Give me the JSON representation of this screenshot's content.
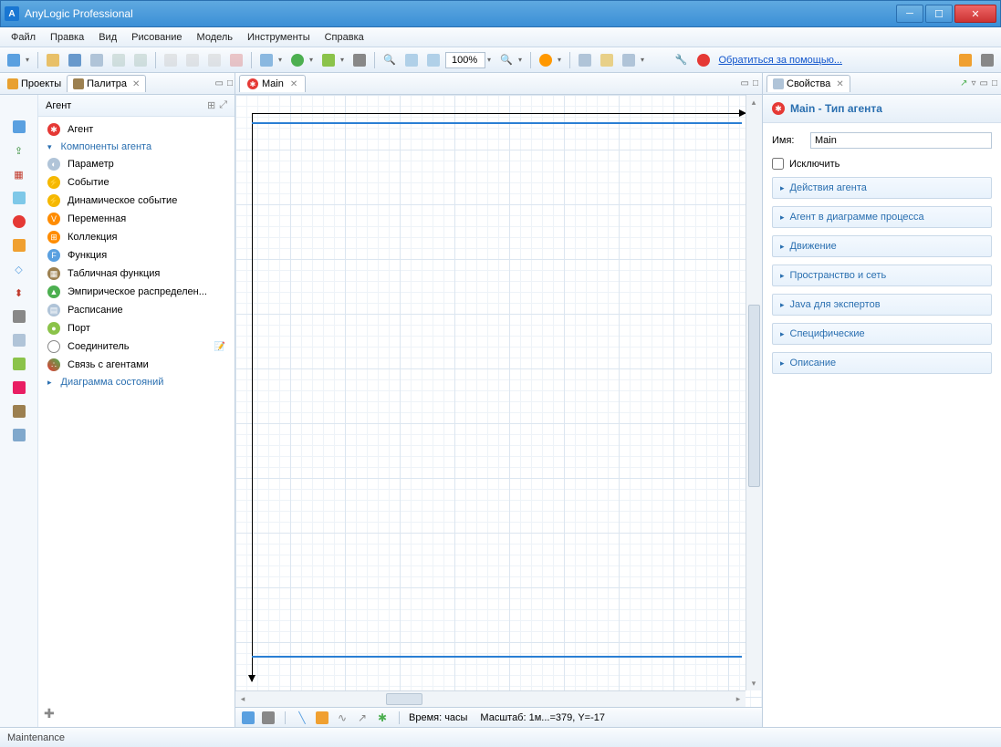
{
  "window": {
    "title": "AnyLogic Professional"
  },
  "menu": {
    "file": "Файл",
    "edit": "Правка",
    "view": "Вид",
    "draw": "Рисование",
    "model": "Модель",
    "tools": "Инструменты",
    "help": "Справка"
  },
  "toolbar": {
    "zoom": "100%",
    "help_link": "Обратиться за помощью..."
  },
  "left": {
    "projects_tab": "Проекты",
    "palette_tab": "Палитра",
    "palette_header": "Агент",
    "items": {
      "agent": "Агент",
      "section_components": "Компоненты агента",
      "parameter": "Параметр",
      "event": "Событие",
      "dyn_event": "Динамическое событие",
      "variable": "Переменная",
      "collection": "Коллекция",
      "function": "Функция",
      "table_func": "Табличная функция",
      "empirical": "Эмпирическое распределен...",
      "schedule": "Расписание",
      "port": "Порт",
      "connector": "Соединитель",
      "agent_link": "Связь с агентами",
      "section_statechart": "Диаграмма состояний"
    }
  },
  "editor": {
    "tab_main": "Main",
    "time_label": "Время: часы",
    "scale_label": "Масштаб: 1м...=379, Y=-17"
  },
  "right": {
    "properties_tab": "Свойства",
    "header": "Main - Тип агента",
    "name_label": "Имя:",
    "name_value": "Main",
    "exclude": "Исключить",
    "sections": {
      "actions": "Действия агента",
      "process": "Агент в диаграмме процесса",
      "movement": "Движение",
      "space": "Пространство и сеть",
      "java": "Java для экспертов",
      "specific": "Специфические",
      "description": "Описание"
    }
  },
  "status": {
    "text": "Maintenance"
  }
}
